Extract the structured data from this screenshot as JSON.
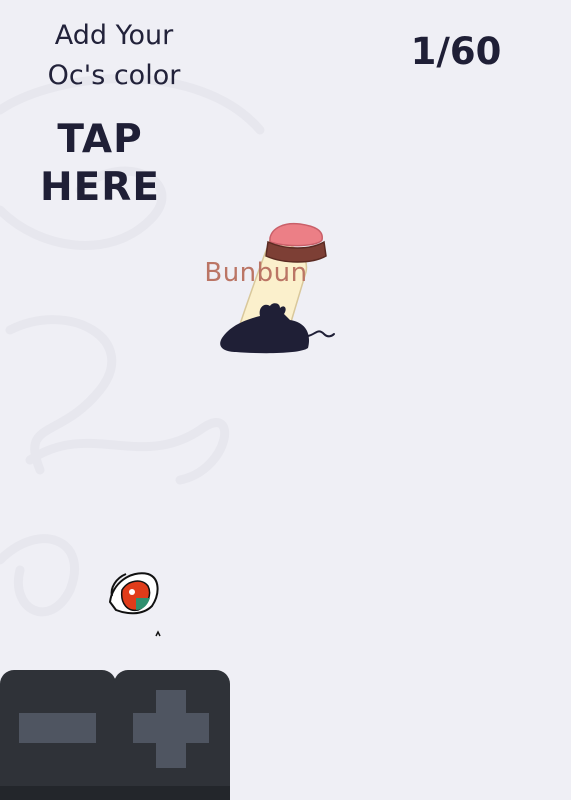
{
  "header": {
    "instruction": "Add Your Oc's color",
    "tap_label": "TAP HERE",
    "counter": "1/60"
  },
  "character": {
    "name": "Bunbun",
    "name_color": "#bb7565",
    "body_color": "#fbf0cc",
    "hair_color": "#ec7f86",
    "band_color": "#7d3f35",
    "mouse_color": "#1f1f36"
  },
  "eye": {
    "iris_color": "#e03c1a",
    "accent_color": "#2f8f6e"
  },
  "controls": {
    "decrease_icon": "minus-icon",
    "increase_icon": "plus-icon",
    "button_color": "#2f3238",
    "glyph_color": "#4f5561"
  },
  "background": {
    "color": "#efeff5"
  }
}
